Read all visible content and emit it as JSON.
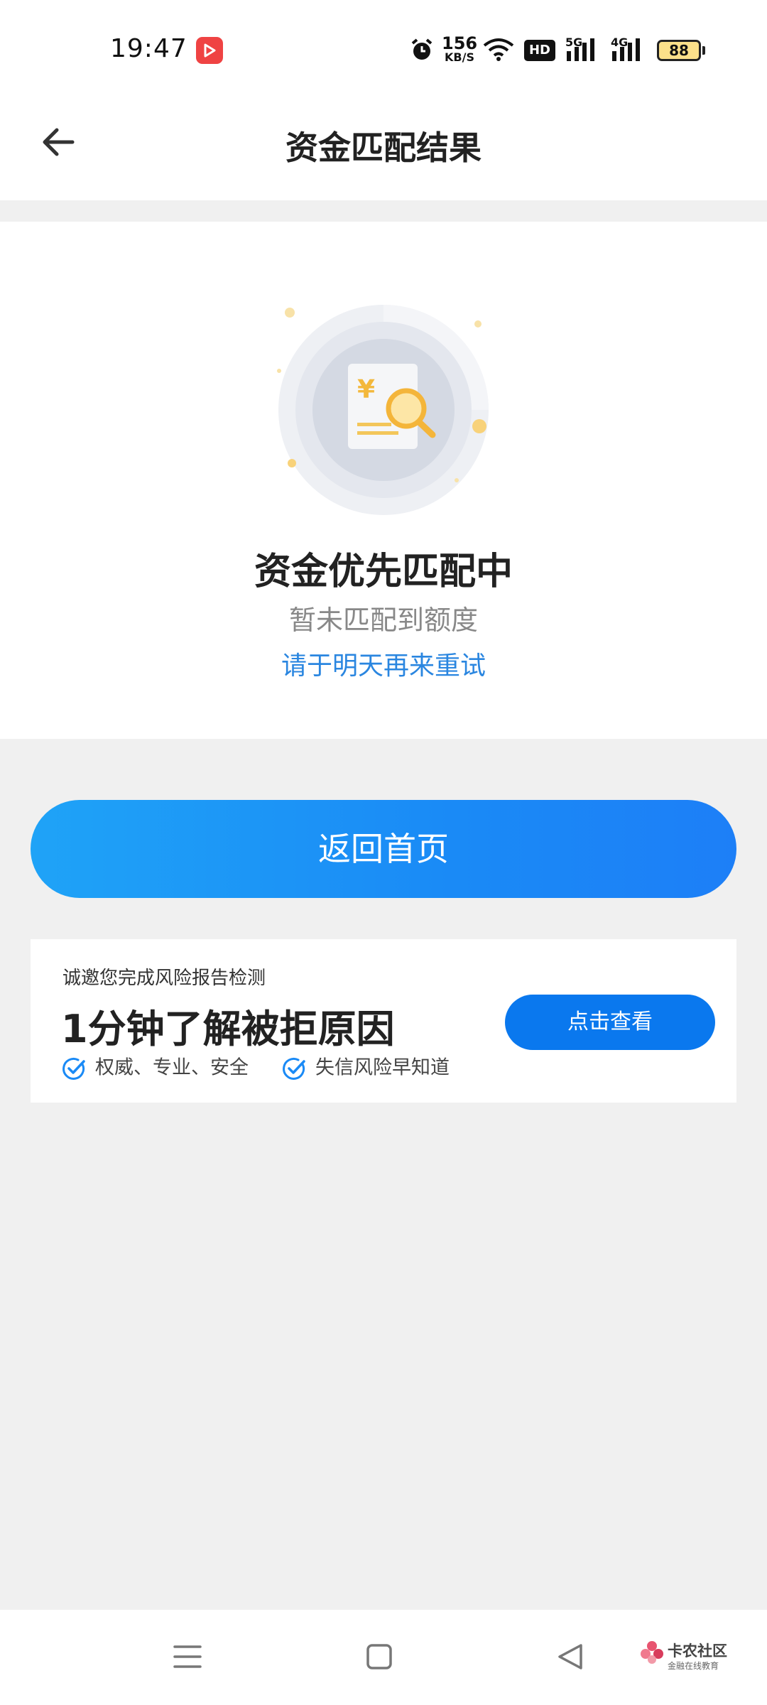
{
  "status_bar": {
    "time": "19:47",
    "net_speed_value": "156",
    "net_speed_unit": "KB/S",
    "hd_label": "HD",
    "signal1_label": "5G",
    "signal2_label": "4G",
    "battery": "88"
  },
  "nav": {
    "title": "资金匹配结果"
  },
  "result": {
    "title": "资金优先匹配中",
    "subtitle": "暂未匹配到额度",
    "retry_text": "请于明天再来重试"
  },
  "home_button": {
    "label": "返回首页"
  },
  "report": {
    "kicker": "诚邀您完成风险报告检测",
    "headline": "1分钟了解被拒原因",
    "features": [
      "权威、专业、安全",
      "失信风险早知道"
    ],
    "button_label": "点击查看"
  },
  "watermark": {
    "main": "卡农社区",
    "sub": "金融在线教育"
  },
  "colors": {
    "accent_blue": "#1a8af6",
    "link_blue": "#2a86e0",
    "button_blue": "#0a78ee",
    "page_bg": "#f0f0f0"
  },
  "icons": {
    "back": "arrow-left-icon",
    "alarm": "alarm-icon",
    "wifi": "wifi-icon",
    "menu": "menu-icon",
    "home": "home-square-icon",
    "back_nav": "triangle-back-icon",
    "check": "check-circle-icon"
  }
}
